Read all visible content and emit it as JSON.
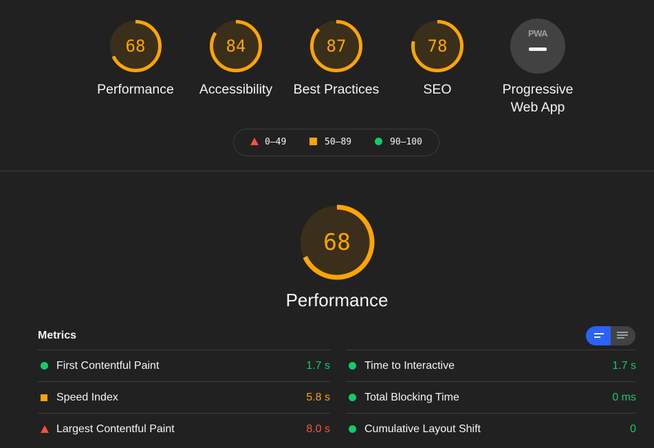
{
  "colors": {
    "fail": "#ff4e42",
    "average": "#ffa400",
    "pass": "#0cce6b",
    "toggle_active": "#2962ff"
  },
  "gauges": [
    {
      "score": "68",
      "label": "Performance"
    },
    {
      "score": "84",
      "label": "Accessibility"
    },
    {
      "score": "87",
      "label": "Best Practices"
    },
    {
      "score": "78",
      "label": "SEO"
    }
  ],
  "pwa": {
    "badge_text": "PWA",
    "label_line1": "Progressive",
    "label_line2": "Web App"
  },
  "legend": {
    "fail": "0–49",
    "average": "50–89",
    "pass": "90–100"
  },
  "main": {
    "score": "68",
    "title": "Performance"
  },
  "metrics": {
    "title": "Metrics",
    "left": [
      {
        "icon": "pass-circle-icon",
        "name": "First Contentful Paint",
        "value": "1.7 s",
        "status": "pass"
      },
      {
        "icon": "average-square-icon",
        "name": "Speed Index",
        "value": "5.8 s",
        "status": "average"
      },
      {
        "icon": "fail-triangle-icon",
        "name": "Largest Contentful Paint",
        "value": "8.0 s",
        "status": "fail"
      }
    ],
    "right": [
      {
        "icon": "pass-circle-icon",
        "name": "Time to Interactive",
        "value": "1.7 s",
        "status": "pass"
      },
      {
        "icon": "pass-circle-icon",
        "name": "Total Blocking Time",
        "value": "0 ms",
        "status": "pass"
      },
      {
        "icon": "pass-circle-icon",
        "name": "Cumulative Layout Shift",
        "value": "0",
        "status": "pass"
      }
    ]
  }
}
